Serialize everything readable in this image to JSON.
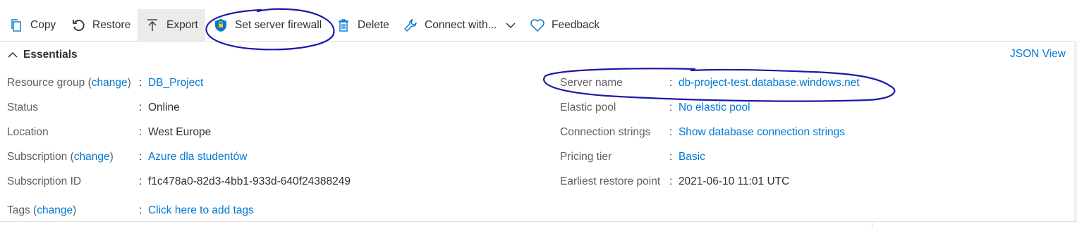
{
  "toolbar": {
    "copy": "Copy",
    "restore": "Restore",
    "export": "Export",
    "set_firewall": "Set server firewall",
    "delete": "Delete",
    "connect_with": "Connect with...",
    "feedback": "Feedback"
  },
  "essentials": {
    "title": "Essentials",
    "json_view": "JSON View",
    "left": {
      "resource_group_label": "Resource group",
      "resource_group_change": "change",
      "resource_group_value": "DB_Project",
      "status_label": "Status",
      "status_value": "Online",
      "location_label": "Location",
      "location_value": "West Europe",
      "subscription_label": "Subscription",
      "subscription_change": "change",
      "subscription_value": "Azure dla studentów",
      "subscription_id_label": "Subscription ID",
      "subscription_id_value": "f1c478a0-82d3-4bb1-933d-640f24388249",
      "tags_label": "Tags",
      "tags_change": "change",
      "tags_value": "Click here to add tags"
    },
    "right": {
      "server_name_label": "Server name",
      "server_name_value": "db-project-test.database.windows.net",
      "elastic_pool_label": "Elastic pool",
      "elastic_pool_value": "No elastic pool",
      "connection_strings_label": "Connection strings",
      "connection_strings_value": "Show database connection strings",
      "pricing_tier_label": "Pricing tier",
      "pricing_tier_value": "Basic",
      "earliest_restore_label": "Earliest restore point",
      "earliest_restore_value": "2021-06-10 11:01 UTC"
    }
  },
  "colors": {
    "link": "#0078d4",
    "annotation_ink": "#1a1aa6",
    "active_button_bg": "#edebe9"
  },
  "icons": [
    "copy-icon",
    "restore-icon",
    "export-icon",
    "shield-icon",
    "trash-icon",
    "wrench-icon",
    "chevron-down-icon",
    "heart-icon",
    "chevron-up-icon"
  ]
}
